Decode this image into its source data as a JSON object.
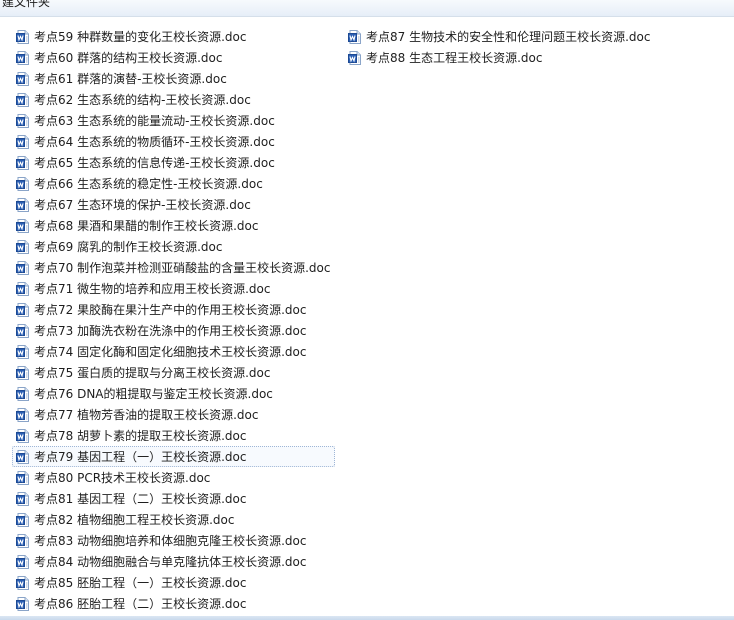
{
  "toolbar": {
    "new_folder_label": "建文件夹"
  },
  "files": {
    "column1": [
      {
        "name": "考点59 种群数量的变化王校长资源.doc"
      },
      {
        "name": "考点60 群落的结构王校长资源.doc"
      },
      {
        "name": "考点61 群落的演替-王校长资源.doc"
      },
      {
        "name": "考点62 生态系统的结构-王校长资源.doc"
      },
      {
        "name": "考点63 生态系统的能量流动-王校长资源.doc"
      },
      {
        "name": "考点64 生态系统的物质循环-王校长资源.doc"
      },
      {
        "name": "考点65 生态系统的信息传递-王校长资源.doc"
      },
      {
        "name": "考点66 生态系统的稳定性-王校长资源.doc"
      },
      {
        "name": "考点67 生态环境的保护-王校长资源.doc"
      },
      {
        "name": "考点68 果酒和果醋的制作王校长资源.doc"
      },
      {
        "name": "考点69 腐乳的制作王校长资源.doc"
      },
      {
        "name": "考点70 制作泡菜并检测亚硝酸盐的含量王校长资源.doc"
      },
      {
        "name": "考点71 微生物的培养和应用王校长资源.doc"
      },
      {
        "name": "考点72 果胶酶在果汁生产中的作用王校长资源.doc"
      },
      {
        "name": "考点73 加酶洗衣粉在洗涤中的作用王校长资源.doc"
      },
      {
        "name": "考点74 固定化酶和固定化细胞技术王校长资源.doc"
      },
      {
        "name": "考点75 蛋白质的提取与分离王校长资源.doc"
      },
      {
        "name": "考点76 DNA的粗提取与鉴定王校长资源.doc"
      },
      {
        "name": "考点77 植物芳香油的提取王校长资源.doc"
      },
      {
        "name": "考点78 胡萝卜素的提取王校长资源.doc"
      },
      {
        "name": "考点79 基因工程（一）王校长资源.doc",
        "selected": true
      },
      {
        "name": "考点80 PCR技术王校长资源.doc"
      },
      {
        "name": "考点81 基因工程（二）王校长资源.doc"
      },
      {
        "name": "考点82 植物细胞工程王校长资源.doc"
      },
      {
        "name": "考点83 动物细胞培养和体细胞克隆王校长资源.doc"
      },
      {
        "name": "考点84 动物细胞融合与单克隆抗体王校长资源.doc"
      },
      {
        "name": "考点85 胚胎工程（一）王校长资源.doc"
      },
      {
        "name": "考点86 胚胎工程（二）王校长资源.doc"
      }
    ],
    "column2": [
      {
        "name": "考点87 生物技术的安全性和伦理问题王校长资源.doc"
      },
      {
        "name": "考点88 生态工程王校长资源.doc"
      }
    ]
  },
  "icons": {
    "file_icon": "word-document-icon"
  },
  "colors": {
    "icon_blue": "#2b5fb3",
    "selection_border": "#c5d6ec",
    "toolbar_bg": "#e6eef8"
  }
}
